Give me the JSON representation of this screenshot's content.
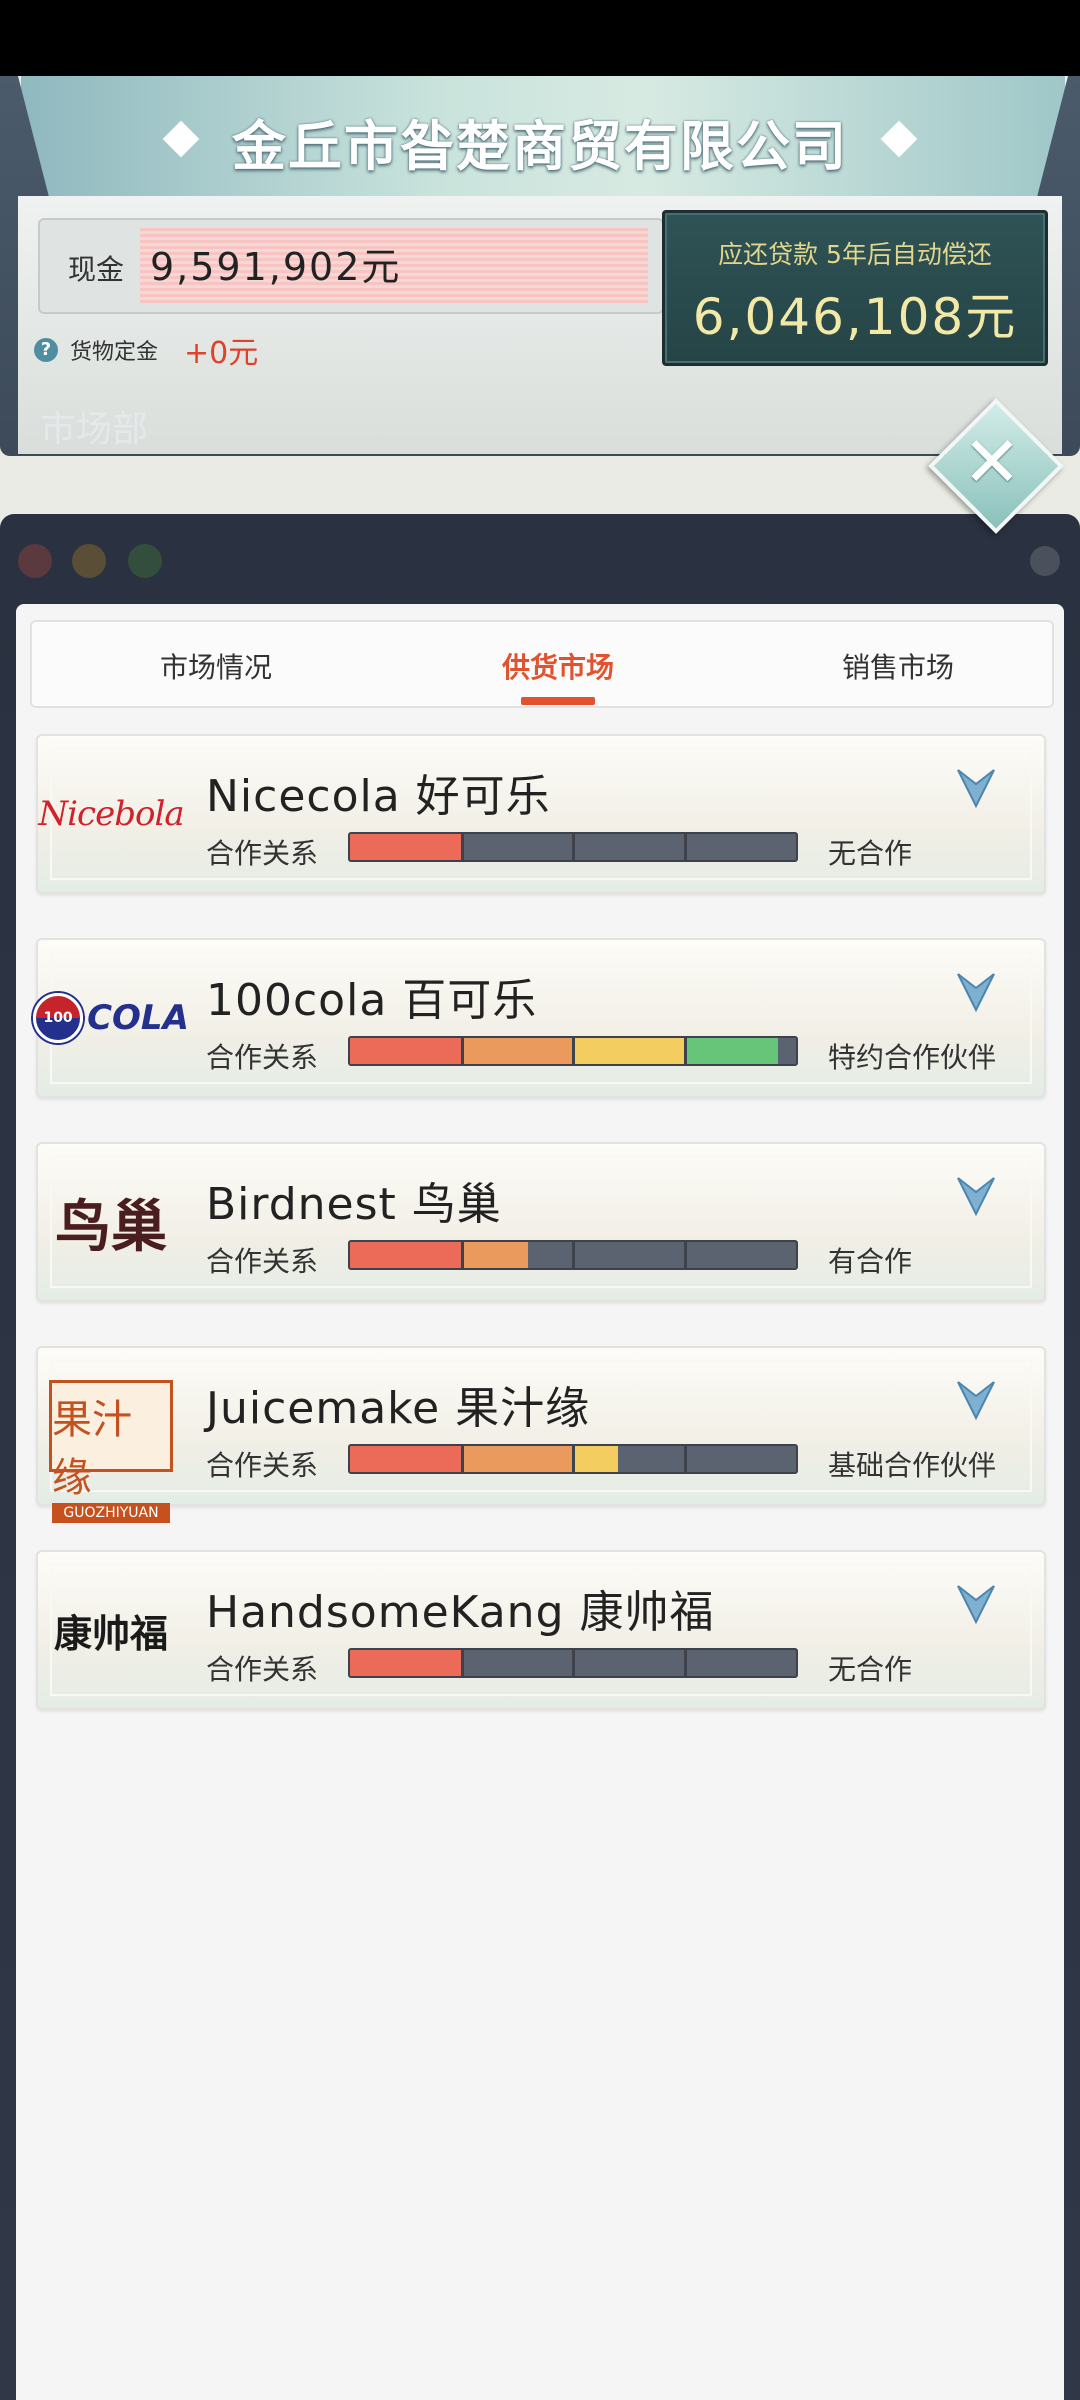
{
  "header": {
    "company_name": "金丘市昝楚商贸有限公司",
    "cash_label": "现金",
    "cash_value": "9,591,902元",
    "deposit_label": "货物定金",
    "deposit_value": "+0元",
    "help_glyph": "?",
    "loan_label": "应还贷款 5年后自动偿还",
    "loan_value": "6,046,108元",
    "department": "市场部",
    "close_glyph": "✕"
  },
  "tabs": [
    {
      "label": "市场情况",
      "active": false
    },
    {
      "label": "供货市场",
      "active": true
    },
    {
      "label": "销售市场",
      "active": false
    }
  ],
  "relation_label": "合作关系",
  "suppliers": [
    {
      "name": "Nicecola 好可乐",
      "logo_text": "Nicebola",
      "status": "无合作",
      "level": 0.25
    },
    {
      "name": "100cola 百可乐",
      "logo_text": "COLA",
      "logo_badge": "100",
      "status": "特约合作伙伴",
      "level": 0.96
    },
    {
      "name": "Birdnest 鸟巢",
      "logo_text": "鸟巢",
      "status": "有合作",
      "level": 0.4
    },
    {
      "name": "Juicemake 果汁缘",
      "logo_text": "果汁缘",
      "logo_subtext": "GUOZHIYUAN",
      "status": "基础合作伙伴",
      "level": 0.6
    },
    {
      "name": "HandsomeKang 康帅福",
      "logo_text": "康帅福",
      "status": "无合作",
      "level": 0.25
    }
  ],
  "colors": {
    "accent": "#e0532e",
    "bar_red": "#ec6a58",
    "bar_orange": "#eb9a5e",
    "bar_yellow": "#f3cd5f",
    "bar_green": "#67c57a",
    "bar_empty": "#5b6270"
  }
}
